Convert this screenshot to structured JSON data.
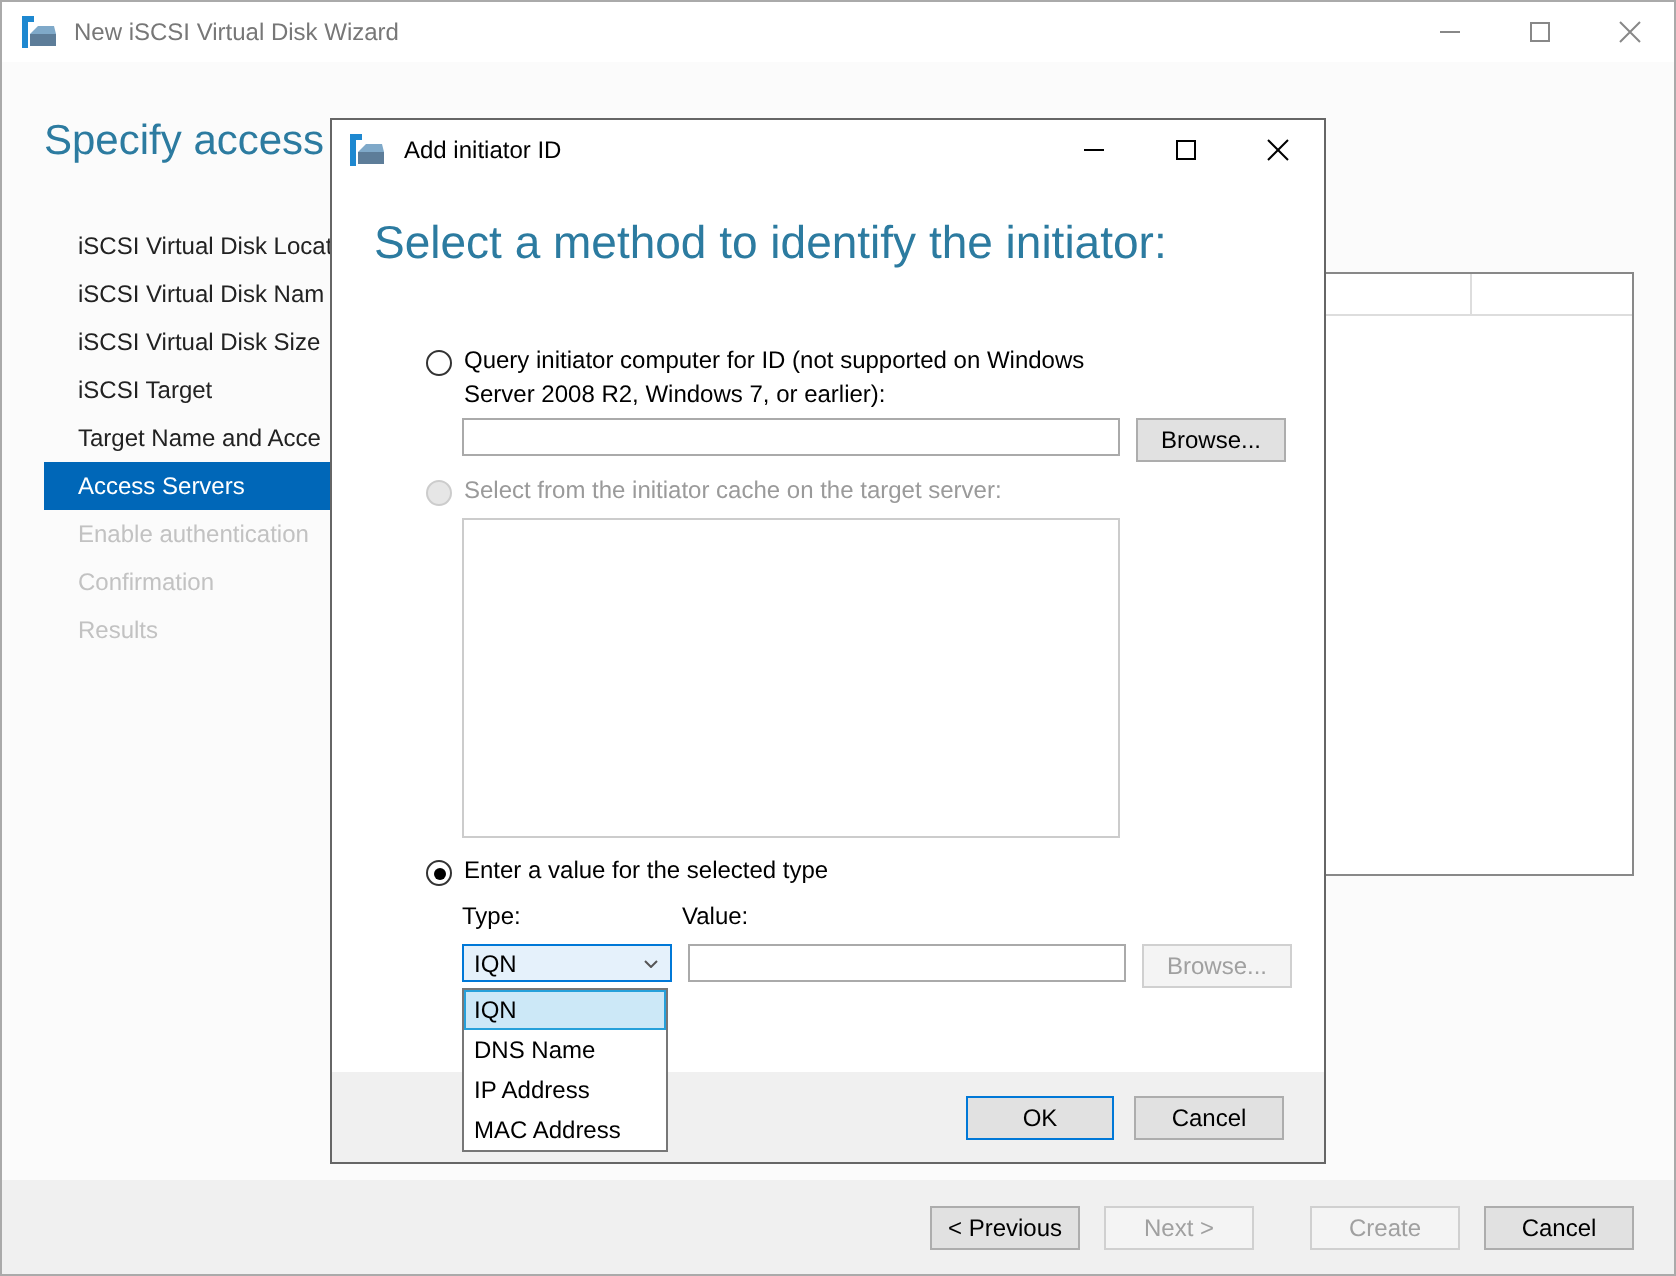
{
  "window": {
    "title": "New iSCSI Virtual Disk Wizard"
  },
  "page_title": "Specify access",
  "steps": [
    {
      "label": "iSCSI Virtual Disk Locat",
      "selected": false,
      "disabled": false
    },
    {
      "label": "iSCSI Virtual Disk Nam",
      "selected": false,
      "disabled": false
    },
    {
      "label": "iSCSI Virtual Disk Size",
      "selected": false,
      "disabled": false
    },
    {
      "label": "iSCSI Target",
      "selected": false,
      "disabled": false
    },
    {
      "label": "Target Name and Acce",
      "selected": false,
      "disabled": false
    },
    {
      "label": "Access Servers",
      "selected": true,
      "disabled": false
    },
    {
      "label": "Enable authentication",
      "selected": false,
      "disabled": true
    },
    {
      "label": "Confirmation",
      "selected": false,
      "disabled": true
    },
    {
      "label": "Results",
      "selected": false,
      "disabled": true
    }
  ],
  "dialog": {
    "title": "Add initiator ID",
    "heading": "Select a method to identify the initiator:",
    "options": [
      {
        "kind": "query",
        "label": "Query initiator computer for ID (not supported on Windows Server 2008 R2, Windows 7, or earlier):",
        "selected": false,
        "disabled": false,
        "browse": {
          "label": "Browse...",
          "disabled": false
        }
      },
      {
        "kind": "cache",
        "label": "Select from the initiator cache on the target server:",
        "selected": false,
        "disabled": true
      },
      {
        "kind": "value",
        "label": "Enter a value for the selected type",
        "selected": true,
        "disabled": false,
        "type_label": "Type:",
        "value_label": "Value:",
        "type_value": "IQN",
        "expanded": true,
        "browse": {
          "label": "Browse...",
          "disabled": true
        },
        "type_options": [
          {
            "label": "IQN",
            "selected": true
          },
          {
            "label": "DNS Name",
            "selected": false
          },
          {
            "label": "IP Address",
            "selected": false
          },
          {
            "label": "MAC Address",
            "selected": false
          }
        ]
      }
    ],
    "buttons": [
      {
        "label": "OK",
        "default": true
      },
      {
        "label": "Cancel",
        "default": false
      }
    ]
  },
  "buttons": [
    {
      "label": "< Previous",
      "disabled": false
    },
    {
      "label": "Next >",
      "disabled": true
    },
    {
      "label": "Create",
      "disabled": true
    },
    {
      "label": "Cancel",
      "disabled": false
    }
  ]
}
